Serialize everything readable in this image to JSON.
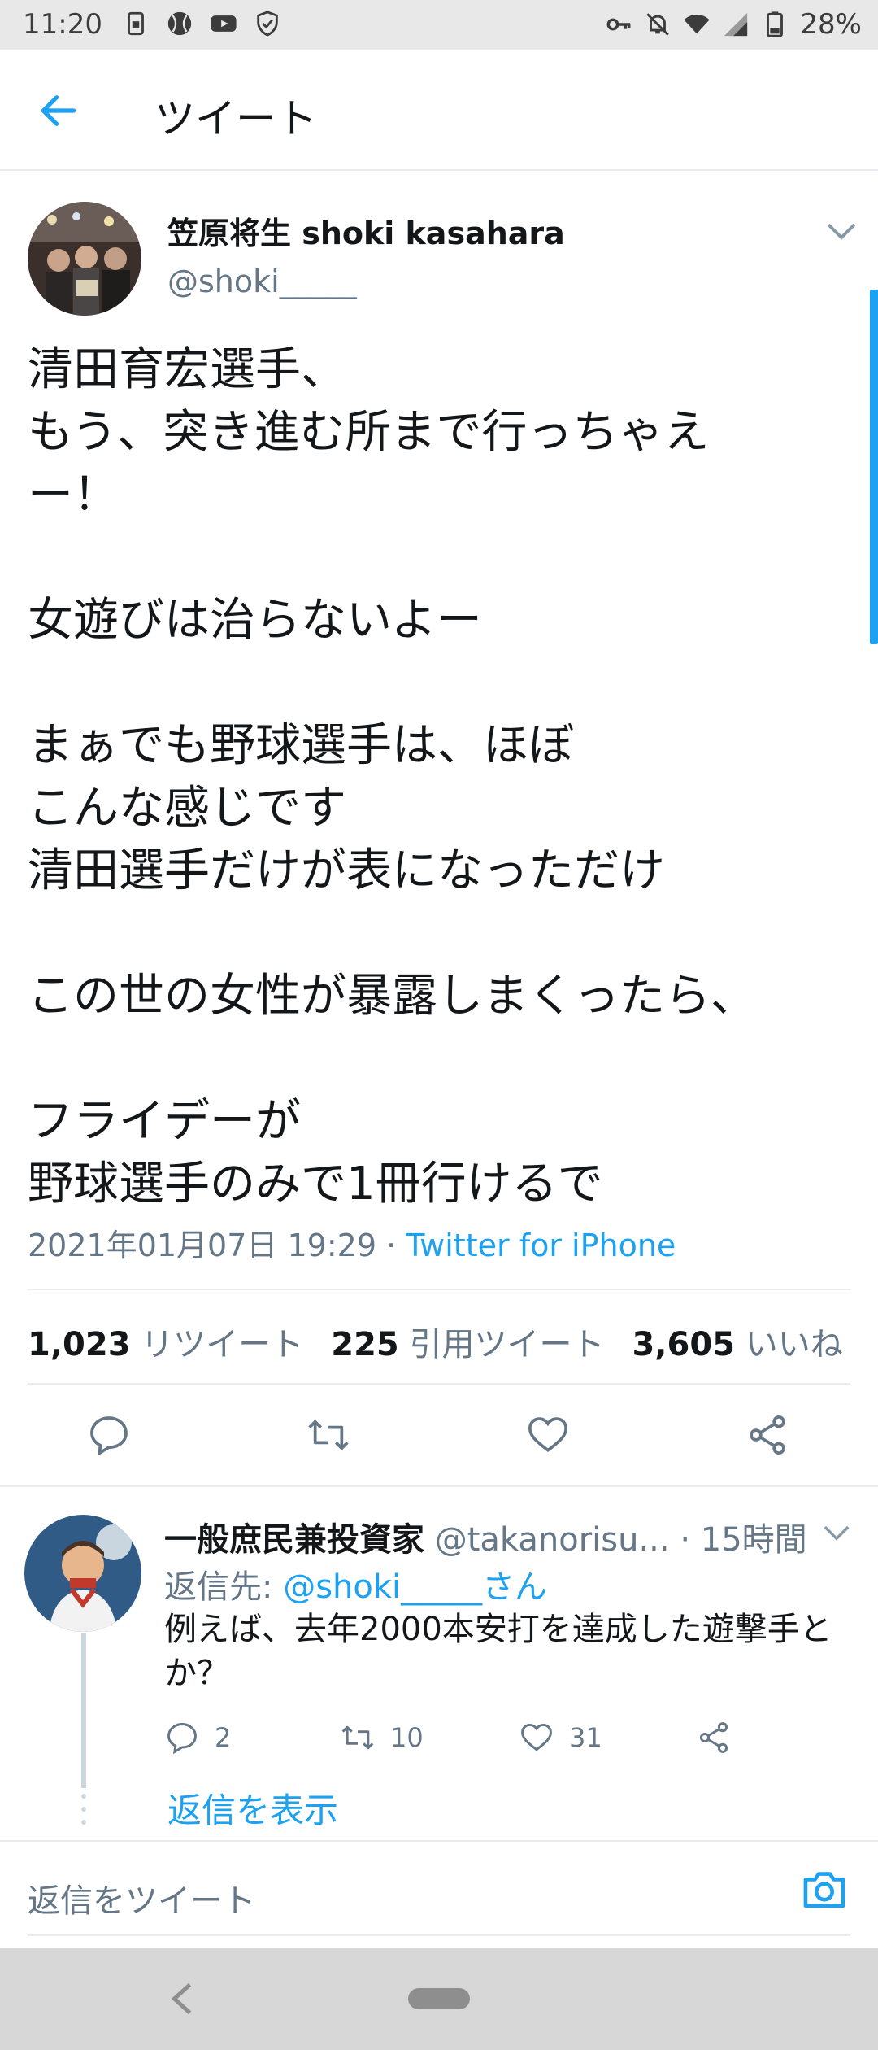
{
  "status_bar": {
    "time": "11:20",
    "battery": "28%",
    "left_icons": [
      "sim-icon",
      "ball-icon",
      "youtube-icon",
      "shield-icon"
    ],
    "right_icons": [
      "key-icon",
      "bell-off-icon",
      "wifi-icon",
      "signal-icon",
      "battery-icon"
    ]
  },
  "header": {
    "title": "ツイート",
    "back_icon": "back-arrow-icon"
  },
  "tweet": {
    "author_name": "笠原将生  shoki kasahara",
    "author_handle": "@shoki_____",
    "lines": [
      "清田育宏選手、",
      "もう、突き進む所まで行っちゃえ",
      "ー！",
      "",
      "女遊びは治らないよー",
      "",
      "まぁでも野球選手は、ほぼ",
      "こんな感じです",
      "清田選手だけが表になっただけ",
      "",
      "この世の女性が暴露しまくったら、",
      "",
      "フライデーが",
      "野球選手のみで1冊行けるで"
    ],
    "timestamp": "2021年01月07日 19:29 · ",
    "source": "Twitter for iPhone",
    "stats": {
      "retweets_count": "1,023",
      "retweets_label": "リツイート",
      "quotes_count": "225",
      "quotes_label": "引用ツイート",
      "likes_count": "3,605",
      "likes_label": "いいね"
    }
  },
  "reply": {
    "name": "一般庶民兼投資家",
    "handle": "@takanorisu...",
    "time": "· 15時間",
    "reply_to_prefix": "返信先: ",
    "reply_to_mention": "@shoki_____さん",
    "text": "例えば、去年2000本安打を達成した遊撃手とか？",
    "reply_count": "2",
    "retweet_count": "10",
    "like_count": "31",
    "show_replies": "返信を表示"
  },
  "compose": {
    "placeholder": "返信をツイート"
  },
  "colors": {
    "accent": "#1da1f2",
    "text": "#14171a",
    "secondary": "#657786",
    "divider": "#e6ecf0"
  }
}
